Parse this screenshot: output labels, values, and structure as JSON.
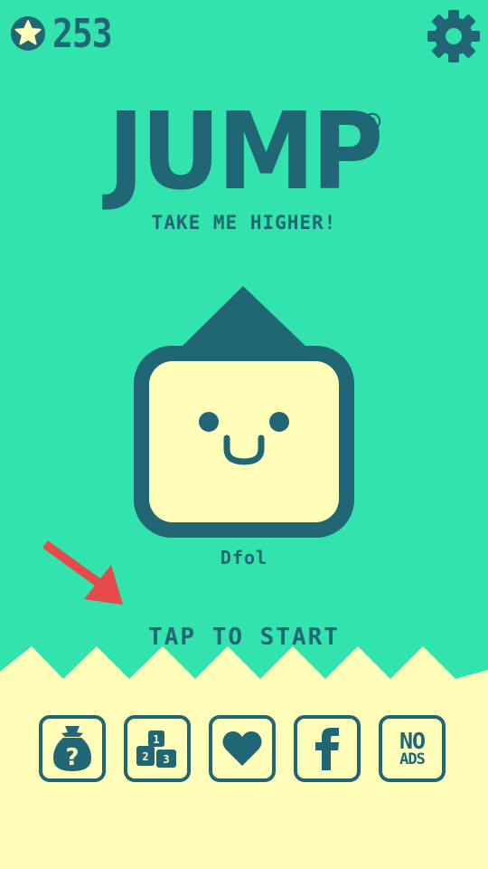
{
  "colors": {
    "background": "#33e3ad",
    "primary": "#216675",
    "cream": "#fffdb8",
    "arrow": "#e64a4a"
  },
  "header": {
    "star_count": "253",
    "star_icon": "star-icon",
    "settings_icon": "gear-icon"
  },
  "title": {
    "logo": "JUMP",
    "registered_mark": "®",
    "subtitle": "TAKE ME HIGHER!"
  },
  "character": {
    "name": "Dfol"
  },
  "tap_to_start": "TAP TO START",
  "bottom_buttons": [
    {
      "name": "mystery-bag-button",
      "icon": "mystery-bag-icon",
      "label": "?"
    },
    {
      "name": "leaderboard-button",
      "icon": "podium-icon",
      "labels": [
        "1",
        "2",
        "3"
      ]
    },
    {
      "name": "like-button",
      "icon": "heart-icon"
    },
    {
      "name": "facebook-button",
      "icon": "facebook-icon",
      "label": "f"
    },
    {
      "name": "no-ads-button",
      "label_top": "NO",
      "label_bottom": "ADS"
    }
  ]
}
